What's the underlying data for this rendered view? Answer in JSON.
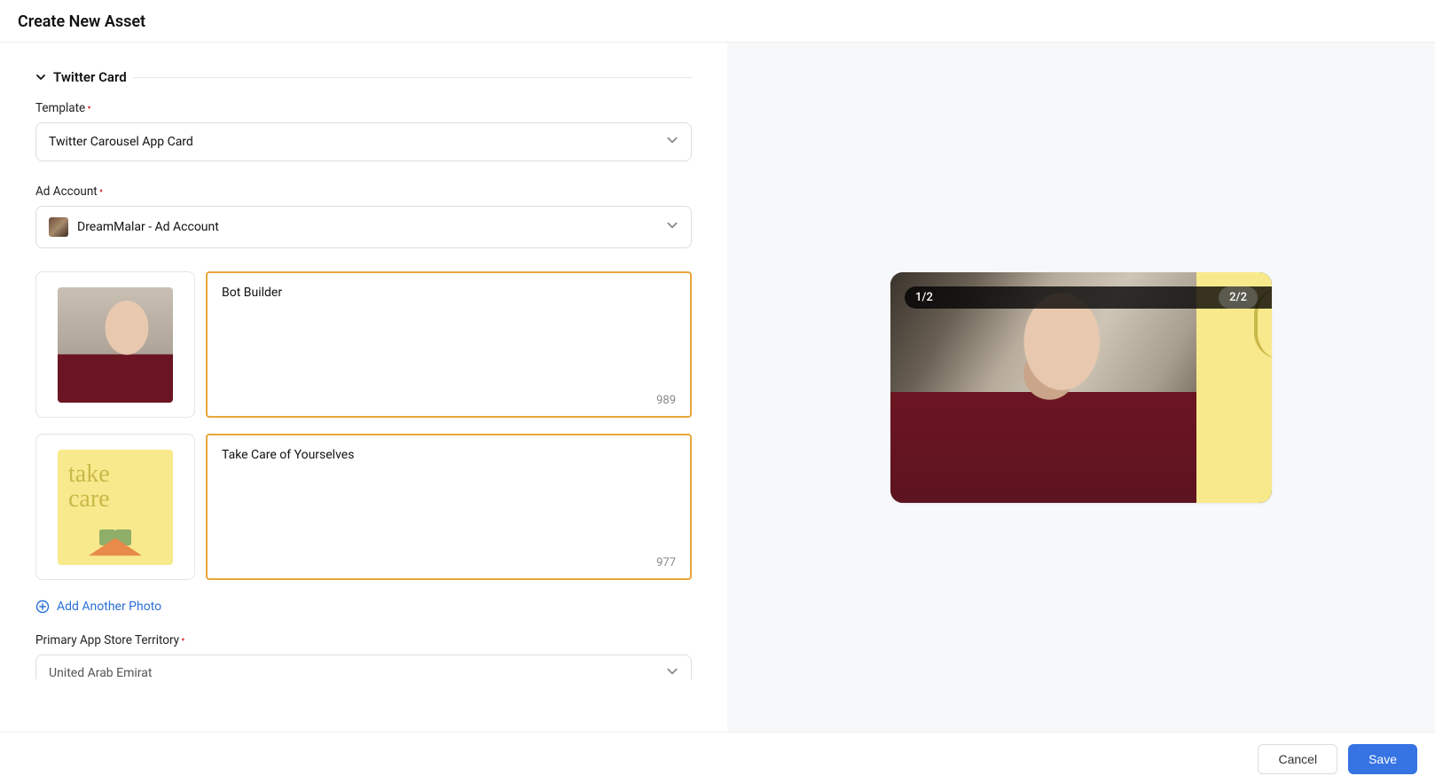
{
  "header": {
    "title": "Create New Asset"
  },
  "section": {
    "title": "Twitter Card"
  },
  "fields": {
    "template": {
      "label": "Template",
      "value": "Twitter Carousel App Card"
    },
    "ad_account": {
      "label": "Ad Account",
      "value": "DreamMalar - Ad Account"
    },
    "territory": {
      "label": "Primary App Store Territory",
      "value": "United Arab Emirat"
    }
  },
  "cards": [
    {
      "title": "Bot Builder",
      "counter": "989",
      "thumb_alt": "facepalm-photo"
    },
    {
      "title": "Take Care of Yourselves",
      "counter": "977",
      "thumb_alt": "take-care-card",
      "thumb_text": "take\ncare"
    }
  ],
  "add_link": "Add Another Photo",
  "preview": {
    "badge_left": "1/2",
    "badge_right": "2/2"
  },
  "footer": {
    "cancel": "Cancel",
    "save": "Save"
  }
}
